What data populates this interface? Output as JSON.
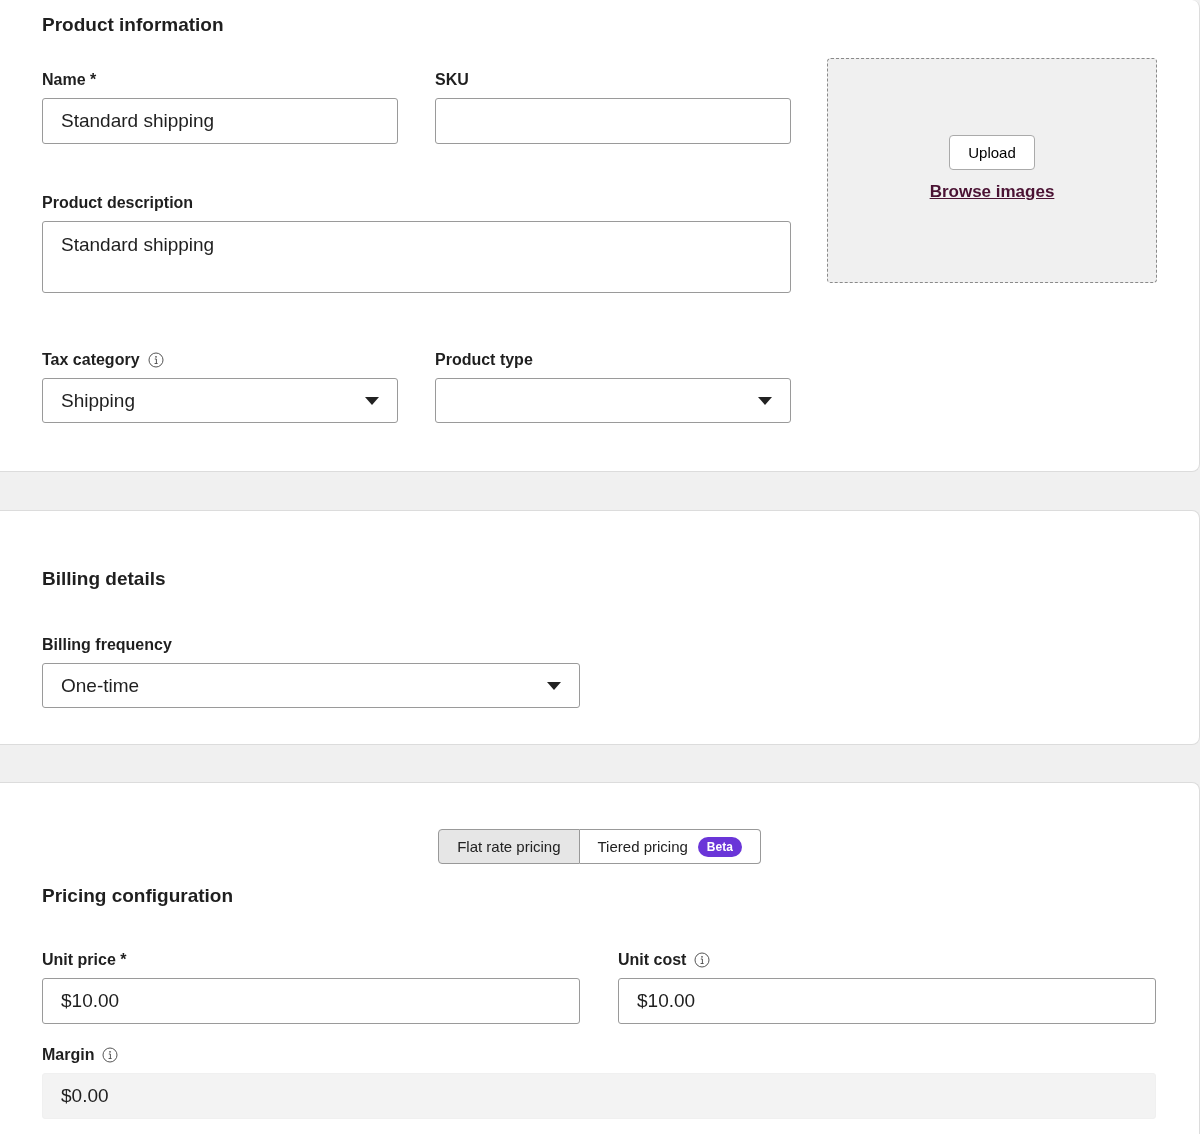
{
  "product_information": {
    "title": "Product information",
    "fields": [
      {
        "label": "Name *",
        "kind": "text",
        "value": "Standard shipping"
      },
      {
        "label": "SKU",
        "kind": "text"
      },
      {
        "label": "Product description",
        "kind": "textarea",
        "value": "Standard shipping"
      },
      {
        "label": "Tax category",
        "kind": "select",
        "info": true,
        "value": "Shipping"
      },
      {
        "label": "Product type",
        "kind": "select"
      }
    ],
    "upload": {
      "button": "Upload",
      "link": "Browse images"
    }
  },
  "billing_details": {
    "title": "Billing details",
    "fields": [
      {
        "label": "Billing frequency",
        "kind": "select",
        "value": "One-time"
      }
    ]
  },
  "pricing_configuration": {
    "title": "Pricing configuration",
    "pricing_tabs": [
      {
        "label": "Flat rate pricing",
        "selected": true
      },
      {
        "label": "Tiered pricing",
        "selected": false,
        "badge": "Beta"
      }
    ],
    "fields": [
      {
        "label": "Unit price *",
        "kind": "text",
        "value": "$10.00"
      },
      {
        "label": "Unit cost",
        "kind": "text",
        "info": true,
        "value": "$10.00"
      },
      {
        "label": "Margin",
        "kind": "readonly",
        "info": true,
        "value": "$0.00"
      }
    ]
  }
}
